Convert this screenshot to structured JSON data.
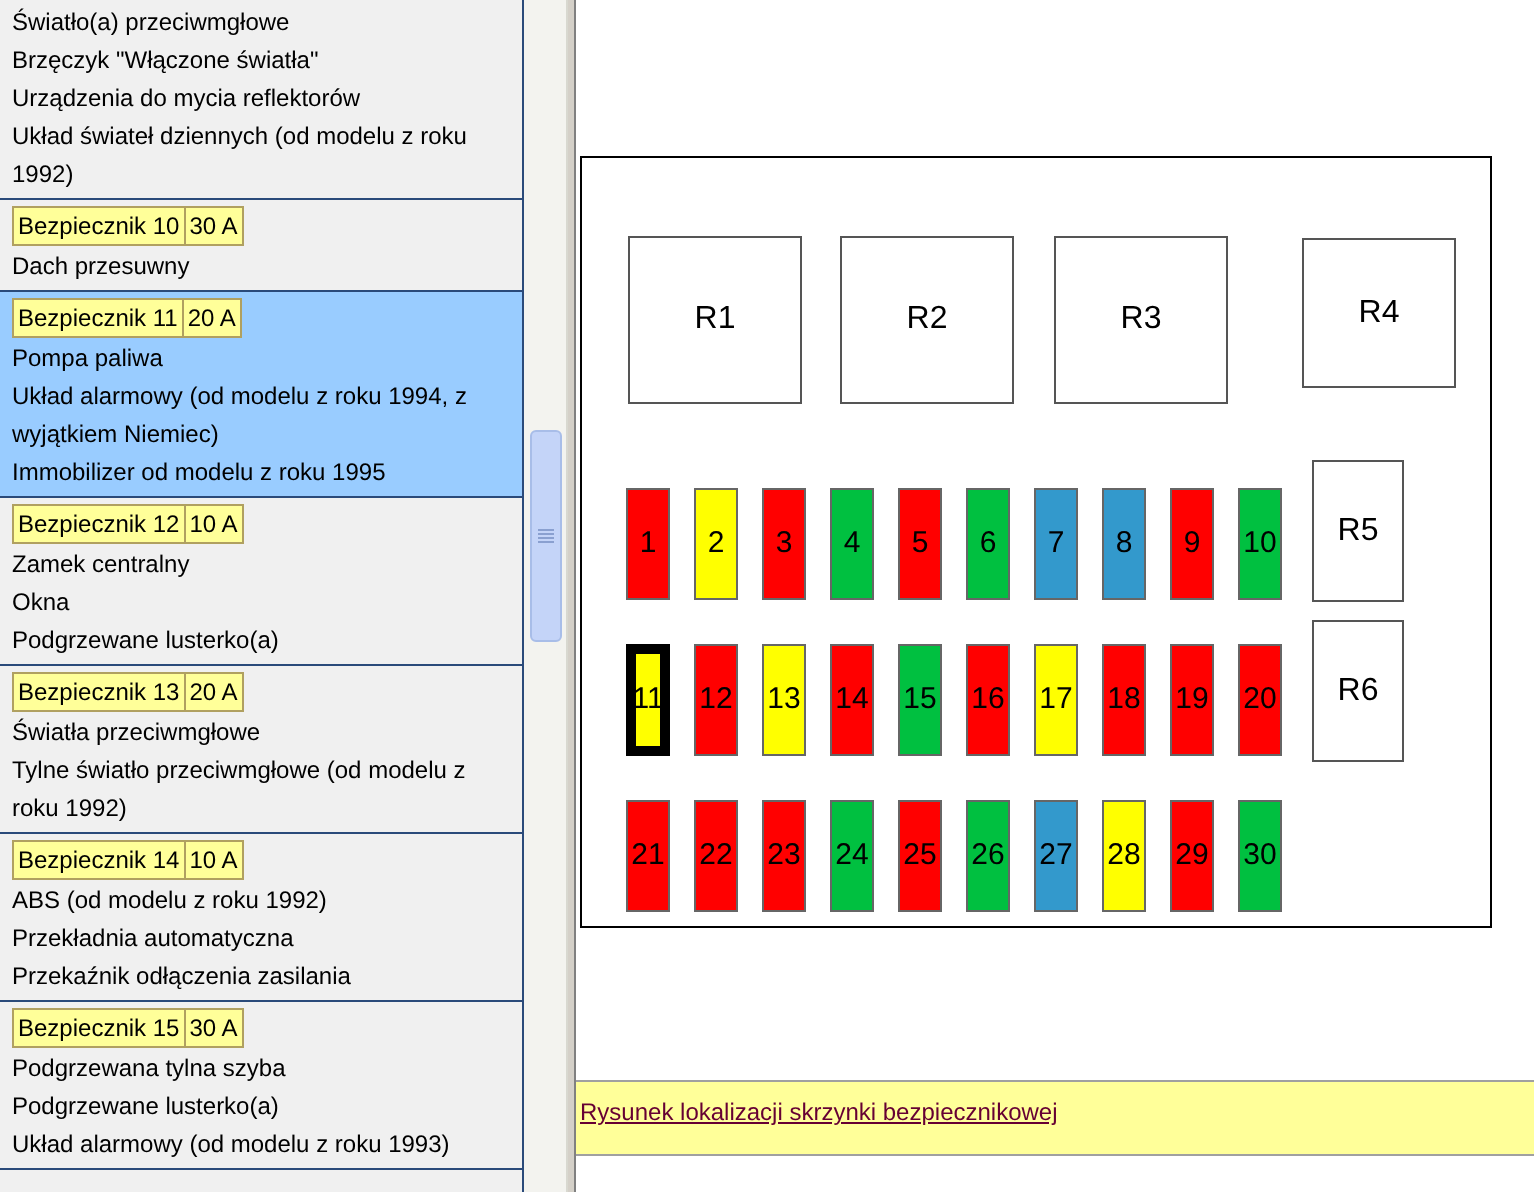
{
  "fuse_list": [
    {
      "items": [
        "Światło(a) przeciwmgłowe",
        "Brzęczyk \"Włączone światła\"",
        "Urządzenia do mycia reflektorów",
        "Układ świateł dziennych (od modelu z roku 1992)"
      ],
      "selected": false
    },
    {
      "fuse": "Bezpiecznik 10",
      "amps": "30 A",
      "items": [
        "Dach przesuwny"
      ],
      "selected": false
    },
    {
      "fuse": "Bezpiecznik 11",
      "amps": "20 A",
      "items": [
        "Pompa paliwa",
        "Układ alarmowy (od modelu z roku 1994, z wyjątkiem Niemiec)",
        "Immobilizer od modelu z roku 1995"
      ],
      "selected": true
    },
    {
      "fuse": "Bezpiecznik 12",
      "amps": "10 A",
      "items": [
        "Zamek centralny",
        "Okna",
        "Podgrzewane lusterko(a)"
      ],
      "selected": false
    },
    {
      "fuse": "Bezpiecznik 13",
      "amps": "20 A",
      "items": [
        "Światła przeciwmgłowe",
        "Tylne światło przeciwmgłowe (od modelu z roku 1992)"
      ],
      "selected": false
    },
    {
      "fuse": "Bezpiecznik 14",
      "amps": "10 A",
      "items": [
        "ABS (od modelu z roku 1992)",
        "Przekładnia automatyczna",
        "Przekaźnik odłączenia zasilania"
      ],
      "selected": false
    },
    {
      "fuse": "Bezpiecznik 15",
      "amps": "30 A",
      "items": [
        "Podgrzewana tylna szyba",
        "Podgrzewane lusterko(a)",
        "Układ alarmowy (od modelu z roku 1993)"
      ],
      "selected": false
    }
  ],
  "diagram": {
    "relays": [
      {
        "label": "R1",
        "kind": "large"
      },
      {
        "label": "R2",
        "kind": "large"
      },
      {
        "label": "R3",
        "kind": "large"
      },
      {
        "label": "R4",
        "kind": "medium"
      },
      {
        "label": "R5",
        "kind": "small"
      },
      {
        "label": "R6",
        "kind": "small"
      }
    ],
    "fuses": [
      {
        "label": "1",
        "color": "#ff0000",
        "selected": false
      },
      {
        "label": "2",
        "color": "#ffff00",
        "selected": false
      },
      {
        "label": "3",
        "color": "#ff0000",
        "selected": false
      },
      {
        "label": "4",
        "color": "#00c040",
        "selected": false
      },
      {
        "label": "5",
        "color": "#ff0000",
        "selected": false
      },
      {
        "label": "6",
        "color": "#00c040",
        "selected": false
      },
      {
        "label": "7",
        "color": "#3399cc",
        "selected": false
      },
      {
        "label": "8",
        "color": "#3399cc",
        "selected": false
      },
      {
        "label": "9",
        "color": "#ff0000",
        "selected": false
      },
      {
        "label": "10",
        "color": "#00c040",
        "selected": false
      },
      {
        "label": "11",
        "color": "#ffff00",
        "selected": true
      },
      {
        "label": "12",
        "color": "#ff0000",
        "selected": false
      },
      {
        "label": "13",
        "color": "#ffff00",
        "selected": false
      },
      {
        "label": "14",
        "color": "#ff0000",
        "selected": false
      },
      {
        "label": "15",
        "color": "#00c040",
        "selected": false
      },
      {
        "label": "16",
        "color": "#ff0000",
        "selected": false
      },
      {
        "label": "17",
        "color": "#ffff00",
        "selected": false
      },
      {
        "label": "18",
        "color": "#ff0000",
        "selected": false
      },
      {
        "label": "19",
        "color": "#ff0000",
        "selected": false
      },
      {
        "label": "20",
        "color": "#ff0000",
        "selected": false
      },
      {
        "label": "21",
        "color": "#ff0000",
        "selected": false
      },
      {
        "label": "22",
        "color": "#ff0000",
        "selected": false
      },
      {
        "label": "23",
        "color": "#ff0000",
        "selected": false
      },
      {
        "label": "24",
        "color": "#00c040",
        "selected": false
      },
      {
        "label": "25",
        "color": "#ff0000",
        "selected": false
      },
      {
        "label": "26",
        "color": "#00c040",
        "selected": false
      },
      {
        "label": "27",
        "color": "#3399cc",
        "selected": false
      },
      {
        "label": "28",
        "color": "#ffff00",
        "selected": false
      },
      {
        "label": "29",
        "color": "#ff0000",
        "selected": false
      },
      {
        "label": "30",
        "color": "#00c040",
        "selected": false
      }
    ]
  },
  "footer": {
    "link": "Rysunek lokalizacji skrzynki bezpiecznikowej"
  }
}
